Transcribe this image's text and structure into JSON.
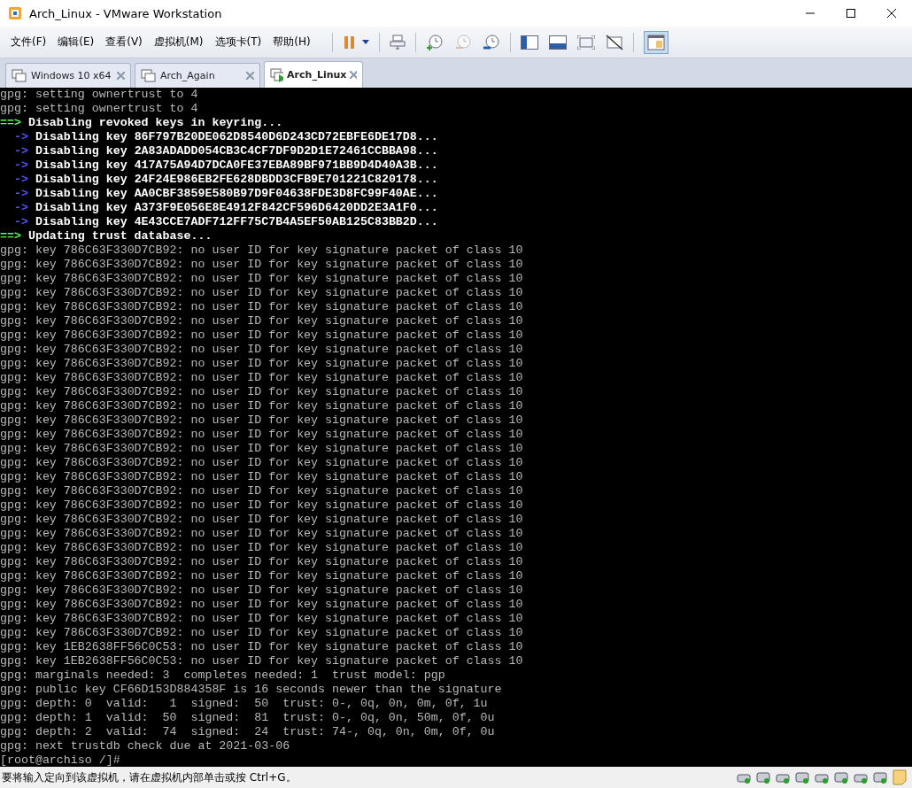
{
  "window": {
    "title": "Arch_Linux - VMware Workstation"
  },
  "menu": [
    "文件(F)",
    "编辑(E)",
    "查看(V)",
    "虚拟机(M)",
    "选项卡(T)",
    "帮助(H)"
  ],
  "tabs": [
    {
      "label": "Windows 10 x64",
      "selected": false,
      "running": false
    },
    {
      "label": "Arch_Again",
      "selected": false,
      "running": false
    },
    {
      "label": "Arch_Linux",
      "selected": true,
      "running": true
    }
  ],
  "terminal": {
    "lines": [
      {
        "kind": "plain",
        "text": "gpg: setting ownertrust to 4"
      },
      {
        "kind": "plain",
        "text": "gpg: setting ownertrust to 4"
      },
      {
        "kind": "header",
        "marker": "==>",
        "text": "Disabling revoked keys in keyring..."
      },
      {
        "kind": "sub",
        "marker": "->",
        "text": "Disabling key 86F797B20DE062D8540D6D243CD72EBFE6DE17D8..."
      },
      {
        "kind": "sub",
        "marker": "->",
        "text": "Disabling key 2A83ADADD054CB3C4CF7DF9D2D1E72461CCBBA98..."
      },
      {
        "kind": "sub",
        "marker": "->",
        "text": "Disabling key 417A75A94D7DCA0FE37EBA89BF971BB9D4D40A3B..."
      },
      {
        "kind": "sub",
        "marker": "->",
        "text": "Disabling key 24F24E986EB2FE628DBDD3CFB9E701221C820178..."
      },
      {
        "kind": "sub",
        "marker": "->",
        "text": "Disabling key AA0CBF3859E580B97D9F04638FDE3D8FC99F40AE..."
      },
      {
        "kind": "sub",
        "marker": "->",
        "text": "Disabling key A373F9E056E8E4912F842CF596D6420DD2E3A1F0..."
      },
      {
        "kind": "sub",
        "marker": "->",
        "text": "Disabling key 4E43CCE7ADF712FF75C7B4A5EF50AB125C83BB2D..."
      },
      {
        "kind": "header",
        "marker": "==>",
        "text": "Updating trust database..."
      },
      {
        "kind": "plain",
        "text": "gpg: key 786C63F330D7CB92: no user ID for key signature packet of class 10"
      },
      {
        "kind": "plain",
        "text": "gpg: key 786C63F330D7CB92: no user ID for key signature packet of class 10"
      },
      {
        "kind": "plain",
        "text": "gpg: key 786C63F330D7CB92: no user ID for key signature packet of class 10"
      },
      {
        "kind": "plain",
        "text": "gpg: key 786C63F330D7CB92: no user ID for key signature packet of class 10"
      },
      {
        "kind": "plain",
        "text": "gpg: key 786C63F330D7CB92: no user ID for key signature packet of class 10"
      },
      {
        "kind": "plain",
        "text": "gpg: key 786C63F330D7CB92: no user ID for key signature packet of class 10"
      },
      {
        "kind": "plain",
        "text": "gpg: key 786C63F330D7CB92: no user ID for key signature packet of class 10"
      },
      {
        "kind": "plain",
        "text": "gpg: key 786C63F330D7CB92: no user ID for key signature packet of class 10"
      },
      {
        "kind": "plain",
        "text": "gpg: key 786C63F330D7CB92: no user ID for key signature packet of class 10"
      },
      {
        "kind": "plain",
        "text": "gpg: key 786C63F330D7CB92: no user ID for key signature packet of class 10"
      },
      {
        "kind": "plain",
        "text": "gpg: key 786C63F330D7CB92: no user ID for key signature packet of class 10"
      },
      {
        "kind": "plain",
        "text": "gpg: key 786C63F330D7CB92: no user ID for key signature packet of class 10"
      },
      {
        "kind": "plain",
        "text": "gpg: key 786C63F330D7CB92: no user ID for key signature packet of class 10"
      },
      {
        "kind": "plain",
        "text": "gpg: key 786C63F330D7CB92: no user ID for key signature packet of class 10"
      },
      {
        "kind": "plain",
        "text": "gpg: key 786C63F330D7CB92: no user ID for key signature packet of class 10"
      },
      {
        "kind": "plain",
        "text": "gpg: key 786C63F330D7CB92: no user ID for key signature packet of class 10"
      },
      {
        "kind": "plain",
        "text": "gpg: key 786C63F330D7CB92: no user ID for key signature packet of class 10"
      },
      {
        "kind": "plain",
        "text": "gpg: key 786C63F330D7CB92: no user ID for key signature packet of class 10"
      },
      {
        "kind": "plain",
        "text": "gpg: key 786C63F330D7CB92: no user ID for key signature packet of class 10"
      },
      {
        "kind": "plain",
        "text": "gpg: key 786C63F330D7CB92: no user ID for key signature packet of class 10"
      },
      {
        "kind": "plain",
        "text": "gpg: key 786C63F330D7CB92: no user ID for key signature packet of class 10"
      },
      {
        "kind": "plain",
        "text": "gpg: key 786C63F330D7CB92: no user ID for key signature packet of class 10"
      },
      {
        "kind": "plain",
        "text": "gpg: key 786C63F330D7CB92: no user ID for key signature packet of class 10"
      },
      {
        "kind": "plain",
        "text": "gpg: key 786C63F330D7CB92: no user ID for key signature packet of class 10"
      },
      {
        "kind": "plain",
        "text": "gpg: key 786C63F330D7CB92: no user ID for key signature packet of class 10"
      },
      {
        "kind": "plain",
        "text": "gpg: key 786C63F330D7CB92: no user ID for key signature packet of class 10"
      },
      {
        "kind": "plain",
        "text": "gpg: key 786C63F330D7CB92: no user ID for key signature packet of class 10"
      },
      {
        "kind": "plain",
        "text": "gpg: key 786C63F330D7CB92: no user ID for key signature packet of class 10"
      },
      {
        "kind": "plain",
        "text": "gpg: key 1EB2638FF56C0C53: no user ID for key signature packet of class 10"
      },
      {
        "kind": "plain",
        "text": "gpg: key 1EB2638FF56C0C53: no user ID for key signature packet of class 10"
      },
      {
        "kind": "plain",
        "text": "gpg: marginals needed: 3  completes needed: 1  trust model: pgp"
      },
      {
        "kind": "plain",
        "text": "gpg: public key CF66D153D884358F is 16 seconds newer than the signature"
      },
      {
        "kind": "plain",
        "text": "gpg: depth: 0  valid:   1  signed:  50  trust: 0-, 0q, 0n, 0m, 0f, 1u"
      },
      {
        "kind": "plain",
        "text": "gpg: depth: 1  valid:  50  signed:  81  trust: 0-, 0q, 0n, 50m, 0f, 0u"
      },
      {
        "kind": "plain",
        "text": "gpg: depth: 2  valid:  74  signed:  24  trust: 74-, 0q, 0n, 0m, 0f, 0u"
      },
      {
        "kind": "plain",
        "text": "gpg: next trustdb check due at 2021-03-06"
      },
      {
        "kind": "plain",
        "text": "[root@archiso /]#"
      }
    ]
  },
  "status_bar": {
    "text": "要将输入定向到该虚拟机，请在虚拟机内部单击或按 Ctrl+G。"
  }
}
